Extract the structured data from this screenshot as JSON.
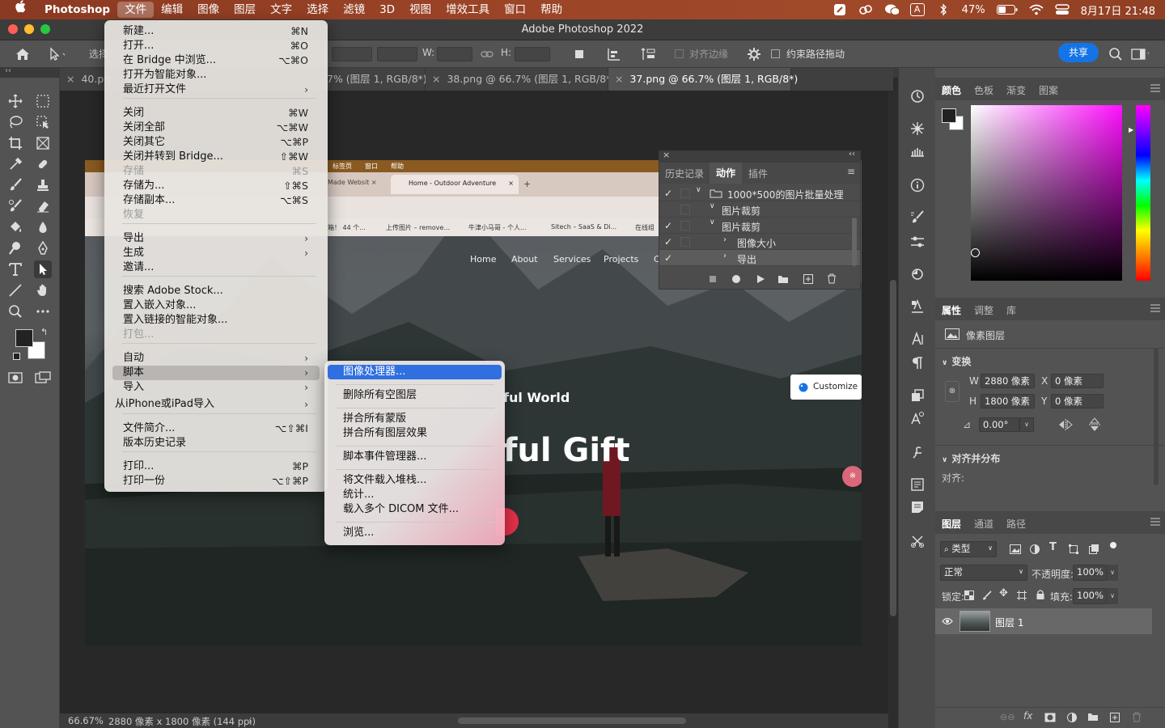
{
  "menubar": {
    "app": "Photoshop",
    "items": [
      "文件",
      "编辑",
      "图像",
      "图层",
      "文字",
      "选择",
      "滤镜",
      "3D",
      "视图",
      "增效工具",
      "窗口",
      "帮助"
    ],
    "battery": "47%",
    "datetime": "8月17日 21:48",
    "input_method": "A"
  },
  "window": {
    "title": "Adobe Photoshop 2022"
  },
  "options": {
    "share": "共享",
    "align_edges": "对齐边缘",
    "constrain": "约束路径拖动",
    "w_label": "W:",
    "h_label": "H:",
    "select_partial": "选择"
  },
  "tabs": [
    {
      "label": "40.pn",
      "active": false
    },
    {
      "label": "7% (图层 1, RGB/8*)",
      "active": false
    },
    {
      "label": "38.png @ 66.7% (图层 1, RGB/8*)",
      "active": false
    },
    {
      "label": "37.png @ 66.7% (图层 1, RGB/8*)",
      "active": true
    }
  ],
  "doc": {
    "browser_menu": [
      "标签页",
      "窗口",
      "帮助"
    ],
    "tab_made": "Made Websit",
    "tab_home": "Home - Outdoor Adventure",
    "bookmarks": [
      "箱！ 44 个...",
      "上传图片 – remove...",
      "牛津小马哥 - 个人...",
      "Sitech – SaaS & Di...",
      "在线组"
    ],
    "nav": [
      "Home",
      "About",
      "Services",
      "Projects",
      "C"
    ],
    "headline_small": "ful World",
    "headline_big": "ful Gift",
    "customize": "Customize"
  },
  "file_menu": {
    "items": [
      {
        "label": "新建...",
        "shortcut": "⌘N"
      },
      {
        "label": "打开...",
        "shortcut": "⌘O"
      },
      {
        "label": "在 Bridge 中浏览...",
        "shortcut": "⌥⌘O"
      },
      {
        "label": "打开为智能对象...",
        "shortcut": ""
      },
      {
        "label": "最近打开文件",
        "shortcut": "",
        "submenu": true
      },
      {
        "label": "关闭",
        "shortcut": "⌘W"
      },
      {
        "label": "关闭全部",
        "shortcut": "⌥⌘W"
      },
      {
        "label": "关闭其它",
        "shortcut": "⌥⌘P"
      },
      {
        "label": "关闭并转到 Bridge...",
        "shortcut": "⇧⌘W"
      },
      {
        "label": "存储",
        "shortcut": "⌘S",
        "disabled": true
      },
      {
        "label": "存储为...",
        "shortcut": "⇧⌘S"
      },
      {
        "label": "存储副本...",
        "shortcut": "⌥⌘S"
      },
      {
        "label": "恢复",
        "shortcut": "",
        "disabled": true
      },
      {
        "label": "导出",
        "shortcut": "",
        "submenu": true
      },
      {
        "label": "生成",
        "shortcut": "",
        "submenu": true
      },
      {
        "label": "邀请...",
        "shortcut": ""
      },
      {
        "label": "搜索 Adobe Stock...",
        "shortcut": ""
      },
      {
        "label": "置入嵌入对象...",
        "shortcut": ""
      },
      {
        "label": "置入链接的智能对象...",
        "shortcut": ""
      },
      {
        "label": "打包...",
        "shortcut": "",
        "disabled": true
      },
      {
        "label": "自动",
        "shortcut": "",
        "submenu": true
      },
      {
        "label": "脚本",
        "shortcut": "",
        "submenu": true,
        "selected": true
      },
      {
        "label": "导入",
        "shortcut": "",
        "submenu": true
      },
      {
        "label": "从iPhone或iPad导入",
        "shortcut": "",
        "submenu": true
      },
      {
        "label": "文件简介...",
        "shortcut": "⌥⇧⌘I"
      },
      {
        "label": "版本历史记录",
        "shortcut": ""
      },
      {
        "label": "打印...",
        "shortcut": "⌘P"
      },
      {
        "label": "打印一份",
        "shortcut": "⌥⇧⌘P"
      }
    ]
  },
  "scripts_menu": {
    "items": [
      "图像处理器...",
      "删除所有空图层",
      "拼合所有蒙版",
      "拼合所有图层效果",
      "脚本事件管理器...",
      "将文件载入堆栈...",
      "统计...",
      "载入多个 DICOM 文件...",
      "浏览..."
    ]
  },
  "actions_panel": {
    "tabs": [
      "历史记录",
      "动作",
      "插件"
    ],
    "rows": [
      "1000*500的图片批量处理",
      "图片裁剪",
      "图片裁剪",
      "图像大小",
      "导出"
    ]
  },
  "color_panel": {
    "tabs": [
      "颜色",
      "色板",
      "渐变",
      "图案"
    ]
  },
  "properties_panel": {
    "tabs": [
      "属性",
      "调整",
      "库"
    ],
    "kind": "像素图层",
    "transform": "变换",
    "w": "2880 像素",
    "h": "1800 像素",
    "x": "0 像素",
    "y": "0 像素",
    "w_lbl": "W",
    "h_lbl": "H",
    "x_lbl": "X",
    "y_lbl": "Y",
    "angle": "0.00°",
    "align": "对齐并分布",
    "align_lbl": "对齐:"
  },
  "layers_panel": {
    "tabs": [
      "图层",
      "通道",
      "路径"
    ],
    "filter": "类型",
    "blend": "正常",
    "opacity_lbl": "不透明度:",
    "opacity": "100%",
    "lock_lbl": "锁定:",
    "fill_lbl": "填充:",
    "fill": "100%",
    "layer": "图层 1"
  },
  "status": {
    "zoom": "66.67%",
    "info": "2880 像素 x 1800 像素 (144 ppi)"
  },
  "colors": {
    "accent": "#1473e6",
    "highlight": "#2f6fe0",
    "menubar": "#9a4326"
  }
}
